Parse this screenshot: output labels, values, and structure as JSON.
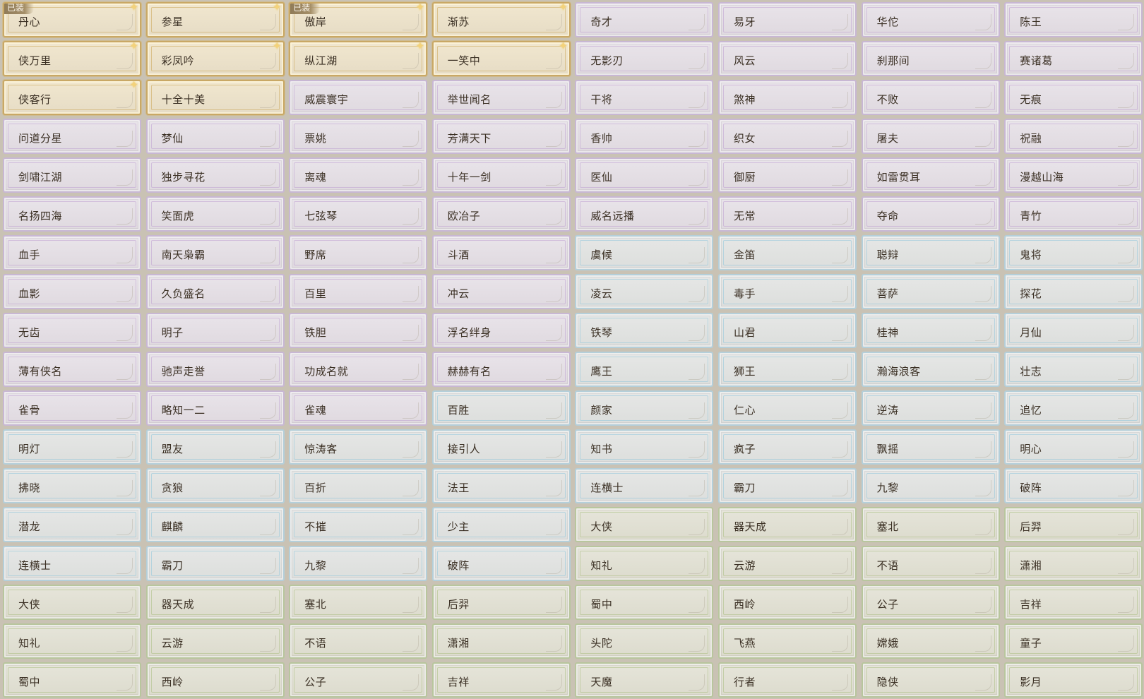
{
  "titles": {
    "equipped_label": "已装",
    "rows": [
      [
        {
          "label": "丹心",
          "tier": "gold",
          "equipped": true,
          "new": true
        },
        {
          "label": "参星",
          "tier": "gold",
          "equipped": false,
          "new": true
        },
        {
          "label": "傲岸",
          "tier": "gold",
          "equipped": true,
          "new": true
        },
        {
          "label": "渐苏",
          "tier": "gold",
          "equipped": false,
          "new": true
        },
        {
          "label": "奇才",
          "tier": "purple",
          "equipped": false,
          "new": false
        },
        {
          "label": "易牙",
          "tier": "purple",
          "equipped": false,
          "new": false
        },
        {
          "label": "华佗",
          "tier": "purple",
          "equipped": false,
          "new": false
        },
        {
          "label": "陈王",
          "tier": "purple",
          "equipped": false,
          "new": false
        }
      ],
      [
        {
          "label": "侠万里",
          "tier": "gold",
          "equipped": false,
          "new": true
        },
        {
          "label": "彩凤吟",
          "tier": "gold",
          "equipped": false,
          "new": true
        },
        {
          "label": "纵江湖",
          "tier": "gold",
          "equipped": false,
          "new": true
        },
        {
          "label": "一笑中",
          "tier": "gold",
          "equipped": false,
          "new": true
        },
        {
          "label": "无影刃",
          "tier": "purple",
          "equipped": false,
          "new": false
        },
        {
          "label": "风云",
          "tier": "purple",
          "equipped": false,
          "new": false
        },
        {
          "label": "刹那间",
          "tier": "purple",
          "equipped": false,
          "new": false
        },
        {
          "label": "赛诸葛",
          "tier": "purple",
          "equipped": false,
          "new": false
        }
      ],
      [
        {
          "label": "侠客行",
          "tier": "gold",
          "equipped": false,
          "new": true
        },
        {
          "label": "十全十美",
          "tier": "gold",
          "equipped": false,
          "new": false
        },
        {
          "label": "威震寰宇",
          "tier": "purple",
          "equipped": false,
          "new": false
        },
        {
          "label": "举世闻名",
          "tier": "purple",
          "equipped": false,
          "new": false
        },
        {
          "label": "干将",
          "tier": "purple",
          "equipped": false,
          "new": false
        },
        {
          "label": "煞神",
          "tier": "purple",
          "equipped": false,
          "new": false
        },
        {
          "label": "不败",
          "tier": "purple",
          "equipped": false,
          "new": false
        },
        {
          "label": "无痕",
          "tier": "purple",
          "equipped": false,
          "new": false
        }
      ],
      [
        {
          "label": "问道分星",
          "tier": "purple",
          "equipped": false,
          "new": false
        },
        {
          "label": "梦仙",
          "tier": "purple",
          "equipped": false,
          "new": false
        },
        {
          "label": "票姚",
          "tier": "purple",
          "equipped": false,
          "new": false
        },
        {
          "label": "芳满天下",
          "tier": "purple",
          "equipped": false,
          "new": false
        },
        {
          "label": "香帅",
          "tier": "purple",
          "equipped": false,
          "new": false
        },
        {
          "label": "织女",
          "tier": "purple",
          "equipped": false,
          "new": false
        },
        {
          "label": "屠夫",
          "tier": "purple",
          "equipped": false,
          "new": false
        },
        {
          "label": "祝融",
          "tier": "purple",
          "equipped": false,
          "new": false
        }
      ],
      [
        {
          "label": "剑啸江湖",
          "tier": "purple",
          "equipped": false,
          "new": false
        },
        {
          "label": "独步寻花",
          "tier": "purple",
          "equipped": false,
          "new": false
        },
        {
          "label": "离魂",
          "tier": "purple",
          "equipped": false,
          "new": false
        },
        {
          "label": "十年一剑",
          "tier": "purple",
          "equipped": false,
          "new": false
        },
        {
          "label": "医仙",
          "tier": "purple",
          "equipped": false,
          "new": false
        },
        {
          "label": "御厨",
          "tier": "purple",
          "equipped": false,
          "new": false
        },
        {
          "label": "如雷贯耳",
          "tier": "purple",
          "equipped": false,
          "new": false
        },
        {
          "label": "漫越山海",
          "tier": "purple",
          "equipped": false,
          "new": false
        }
      ],
      [
        {
          "label": "名扬四海",
          "tier": "purple",
          "equipped": false,
          "new": false
        },
        {
          "label": "笑面虎",
          "tier": "purple",
          "equipped": false,
          "new": false
        },
        {
          "label": "七弦琴",
          "tier": "purple",
          "equipped": false,
          "new": false
        },
        {
          "label": "欧冶子",
          "tier": "purple",
          "equipped": false,
          "new": false
        },
        {
          "label": "威名远播",
          "tier": "purple",
          "equipped": false,
          "new": false
        },
        {
          "label": "无常",
          "tier": "purple",
          "equipped": false,
          "new": false
        },
        {
          "label": "夺命",
          "tier": "purple",
          "equipped": false,
          "new": false
        },
        {
          "label": "青竹",
          "tier": "purple",
          "equipped": false,
          "new": false
        }
      ],
      [
        {
          "label": "血手",
          "tier": "purple",
          "equipped": false,
          "new": false
        },
        {
          "label": "南天枭霸",
          "tier": "purple",
          "equipped": false,
          "new": false
        },
        {
          "label": "野席",
          "tier": "purple",
          "equipped": false,
          "new": false
        },
        {
          "label": "斗酒",
          "tier": "purple",
          "equipped": false,
          "new": false
        },
        {
          "label": "虞候",
          "tier": "blue",
          "equipped": false,
          "new": false
        },
        {
          "label": "金笛",
          "tier": "blue",
          "equipped": false,
          "new": false
        },
        {
          "label": "聪辩",
          "tier": "blue",
          "equipped": false,
          "new": false
        },
        {
          "label": "鬼将",
          "tier": "blue",
          "equipped": false,
          "new": false
        }
      ],
      [
        {
          "label": "血影",
          "tier": "purple",
          "equipped": false,
          "new": false
        },
        {
          "label": "久负盛名",
          "tier": "purple",
          "equipped": false,
          "new": false
        },
        {
          "label": "百里",
          "tier": "purple",
          "equipped": false,
          "new": false
        },
        {
          "label": "冲云",
          "tier": "purple",
          "equipped": false,
          "new": false
        },
        {
          "label": "凌云",
          "tier": "blue",
          "equipped": false,
          "new": false
        },
        {
          "label": "毒手",
          "tier": "blue",
          "equipped": false,
          "new": false
        },
        {
          "label": "菩萨",
          "tier": "blue",
          "equipped": false,
          "new": false
        },
        {
          "label": "探花",
          "tier": "blue",
          "equipped": false,
          "new": false
        }
      ],
      [
        {
          "label": "无齿",
          "tier": "purple",
          "equipped": false,
          "new": false
        },
        {
          "label": "明子",
          "tier": "purple",
          "equipped": false,
          "new": false
        },
        {
          "label": "铁胆",
          "tier": "purple",
          "equipped": false,
          "new": false
        },
        {
          "label": "浮名绊身",
          "tier": "purple",
          "equipped": false,
          "new": false
        },
        {
          "label": "铁琴",
          "tier": "blue",
          "equipped": false,
          "new": false
        },
        {
          "label": "山君",
          "tier": "blue",
          "equipped": false,
          "new": false
        },
        {
          "label": "桂神",
          "tier": "blue",
          "equipped": false,
          "new": false
        },
        {
          "label": "月仙",
          "tier": "blue",
          "equipped": false,
          "new": false
        }
      ],
      [
        {
          "label": "薄有侠名",
          "tier": "purple",
          "equipped": false,
          "new": false
        },
        {
          "label": "驰声走誉",
          "tier": "purple",
          "equipped": false,
          "new": false
        },
        {
          "label": "功成名就",
          "tier": "purple",
          "equipped": false,
          "new": false
        },
        {
          "label": "赫赫有名",
          "tier": "purple",
          "equipped": false,
          "new": false
        },
        {
          "label": "鹰王",
          "tier": "blue",
          "equipped": false,
          "new": false
        },
        {
          "label": "狮王",
          "tier": "blue",
          "equipped": false,
          "new": false
        },
        {
          "label": "瀚海浪客",
          "tier": "blue",
          "equipped": false,
          "new": false
        },
        {
          "label": "壮志",
          "tier": "blue",
          "equipped": false,
          "new": false
        }
      ],
      [
        {
          "label": "雀骨",
          "tier": "purple",
          "equipped": false,
          "new": false
        },
        {
          "label": "略知一二",
          "tier": "purple",
          "equipped": false,
          "new": false
        },
        {
          "label": "雀魂",
          "tier": "purple",
          "equipped": false,
          "new": false
        },
        {
          "label": "百胜",
          "tier": "blue",
          "equipped": false,
          "new": false
        },
        {
          "label": "颜家",
          "tier": "blue",
          "equipped": false,
          "new": false
        },
        {
          "label": "仁心",
          "tier": "blue",
          "equipped": false,
          "new": false
        },
        {
          "label": "逆涛",
          "tier": "blue",
          "equipped": false,
          "new": false
        },
        {
          "label": "追忆",
          "tier": "blue",
          "equipped": false,
          "new": false
        }
      ],
      [
        {
          "label": "明灯",
          "tier": "blue",
          "equipped": false,
          "new": false
        },
        {
          "label": "盟友",
          "tier": "blue",
          "equipped": false,
          "new": false
        },
        {
          "label": "惊涛客",
          "tier": "blue",
          "equipped": false,
          "new": false
        },
        {
          "label": "接引人",
          "tier": "blue",
          "equipped": false,
          "new": false
        },
        {
          "label": "知书",
          "tier": "blue",
          "equipped": false,
          "new": false
        },
        {
          "label": "疯子",
          "tier": "blue",
          "equipped": false,
          "new": false
        },
        {
          "label": "飘摇",
          "tier": "blue",
          "equipped": false,
          "new": false
        },
        {
          "label": "明心",
          "tier": "blue",
          "equipped": false,
          "new": false
        }
      ],
      [
        {
          "label": "拂晓",
          "tier": "blue",
          "equipped": false,
          "new": false
        },
        {
          "label": "贪狼",
          "tier": "blue",
          "equipped": false,
          "new": false
        },
        {
          "label": "百折",
          "tier": "blue",
          "equipped": false,
          "new": false
        },
        {
          "label": "法王",
          "tier": "blue",
          "equipped": false,
          "new": false
        },
        {
          "label": "连横士",
          "tier": "blue",
          "equipped": false,
          "new": false
        },
        {
          "label": "霸刀",
          "tier": "blue",
          "equipped": false,
          "new": false
        },
        {
          "label": "九黎",
          "tier": "blue",
          "equipped": false,
          "new": false
        },
        {
          "label": "破阵",
          "tier": "blue",
          "equipped": false,
          "new": false
        }
      ],
      [
        {
          "label": "潜龙",
          "tier": "blue",
          "equipped": false,
          "new": false
        },
        {
          "label": "麒麟",
          "tier": "blue",
          "equipped": false,
          "new": false
        },
        {
          "label": "不摧",
          "tier": "blue",
          "equipped": false,
          "new": false
        },
        {
          "label": "少主",
          "tier": "blue",
          "equipped": false,
          "new": false
        },
        {
          "label": "大侠",
          "tier": "green",
          "equipped": false,
          "new": false
        },
        {
          "label": "器天成",
          "tier": "green",
          "equipped": false,
          "new": false
        },
        {
          "label": "塞北",
          "tier": "green",
          "equipped": false,
          "new": false
        },
        {
          "label": "后羿",
          "tier": "green",
          "equipped": false,
          "new": false
        }
      ],
      [
        {
          "label": "连横士",
          "tier": "blue",
          "equipped": false,
          "new": false
        },
        {
          "label": "霸刀",
          "tier": "blue",
          "equipped": false,
          "new": false
        },
        {
          "label": "九黎",
          "tier": "blue",
          "equipped": false,
          "new": false
        },
        {
          "label": "破阵",
          "tier": "blue",
          "equipped": false,
          "new": false
        },
        {
          "label": "知礼",
          "tier": "green",
          "equipped": false,
          "new": false
        },
        {
          "label": "云游",
          "tier": "green",
          "equipped": false,
          "new": false
        },
        {
          "label": "不语",
          "tier": "green",
          "equipped": false,
          "new": false
        },
        {
          "label": "潇湘",
          "tier": "green",
          "equipped": false,
          "new": false
        }
      ],
      [
        {
          "label": "大侠",
          "tier": "green",
          "equipped": false,
          "new": false
        },
        {
          "label": "器天成",
          "tier": "green",
          "equipped": false,
          "new": false
        },
        {
          "label": "塞北",
          "tier": "green",
          "equipped": false,
          "new": false
        },
        {
          "label": "后羿",
          "tier": "green",
          "equipped": false,
          "new": false
        },
        {
          "label": "蜀中",
          "tier": "green",
          "equipped": false,
          "new": false
        },
        {
          "label": "西岭",
          "tier": "green",
          "equipped": false,
          "new": false
        },
        {
          "label": "公子",
          "tier": "green",
          "equipped": false,
          "new": false
        },
        {
          "label": "吉祥",
          "tier": "green",
          "equipped": false,
          "new": false
        }
      ],
      [
        {
          "label": "知礼",
          "tier": "green",
          "equipped": false,
          "new": false
        },
        {
          "label": "云游",
          "tier": "green",
          "equipped": false,
          "new": false
        },
        {
          "label": "不语",
          "tier": "green",
          "equipped": false,
          "new": false
        },
        {
          "label": "潇湘",
          "tier": "green",
          "equipped": false,
          "new": false
        },
        {
          "label": "头陀",
          "tier": "green",
          "equipped": false,
          "new": false
        },
        {
          "label": "飞燕",
          "tier": "green",
          "equipped": false,
          "new": false
        },
        {
          "label": "嫦娥",
          "tier": "green",
          "equipped": false,
          "new": false
        },
        {
          "label": "童子",
          "tier": "green",
          "equipped": false,
          "new": false
        }
      ],
      [
        {
          "label": "蜀中",
          "tier": "green",
          "equipped": false,
          "new": false
        },
        {
          "label": "西岭",
          "tier": "green",
          "equipped": false,
          "new": false
        },
        {
          "label": "公子",
          "tier": "green",
          "equipped": false,
          "new": false
        },
        {
          "label": "吉祥",
          "tier": "green",
          "equipped": false,
          "new": false
        },
        {
          "label": "天魔",
          "tier": "green",
          "equipped": false,
          "new": false
        },
        {
          "label": "行者",
          "tier": "green",
          "equipped": false,
          "new": false
        },
        {
          "label": "隐侠",
          "tier": "green",
          "equipped": false,
          "new": false
        },
        {
          "label": "影月",
          "tier": "green",
          "equipped": false,
          "new": false
        }
      ]
    ]
  }
}
